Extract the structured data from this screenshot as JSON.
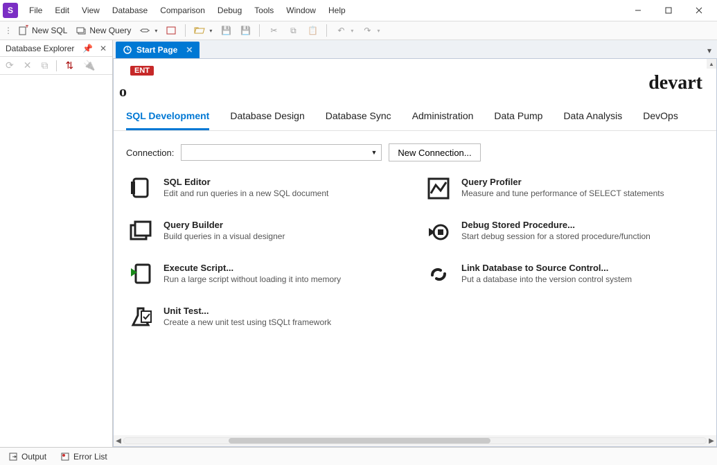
{
  "menu": {
    "items": [
      "File",
      "Edit",
      "View",
      "Database",
      "Comparison",
      "Debug",
      "Tools",
      "Window",
      "Help"
    ]
  },
  "toolbar": {
    "newSql": "New SQL",
    "newQuery": "New Query"
  },
  "explorer": {
    "title": "Database Explorer"
  },
  "tab": {
    "title": "Start Page"
  },
  "brand": {
    "badge": "ENT",
    "logoText": "devart"
  },
  "subtabs": [
    "SQL Development",
    "Database Design",
    "Database Sync",
    "Administration",
    "Data Pump",
    "Data Analysis",
    "DevOps"
  ],
  "connection": {
    "label": "Connection:",
    "value": "",
    "newBtn": "New Connection..."
  },
  "tiles": {
    "left": [
      {
        "title": "SQL Editor",
        "desc": "Edit and run queries in a new SQL document"
      },
      {
        "title": "Query Builder",
        "desc": "Build queries in a visual designer"
      },
      {
        "title": "Execute Script...",
        "desc": "Run a large script without loading it into memory"
      },
      {
        "title": "Unit Test...",
        "desc": "Create a new unit test using tSQLt framework"
      }
    ],
    "right": [
      {
        "title": "Query Profiler",
        "desc": "Measure and tune performance of SELECT statements"
      },
      {
        "title": "Debug Stored Procedure...",
        "desc": "Start debug session for a stored procedure/function"
      },
      {
        "title": "Link Database to Source Control...",
        "desc": "Put a database into the version control system"
      }
    ]
  },
  "bottomPanels": {
    "output": "Output",
    "errorList": "Error List"
  }
}
